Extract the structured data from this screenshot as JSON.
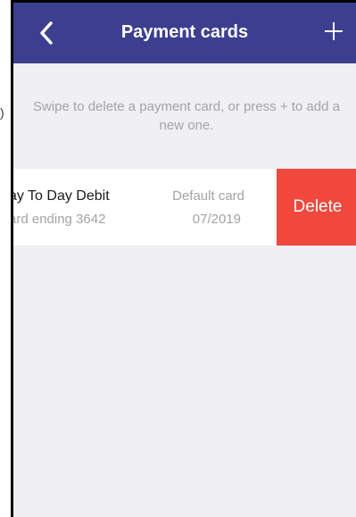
{
  "outer": {
    "fragment": ")"
  },
  "navbar": {
    "title": "Payment cards",
    "back_icon": "chevron-left-icon",
    "add_icon": "plus-icon",
    "background": "#3c3f8f"
  },
  "hint": {
    "text": "Swipe to delete a payment card, or press + to add a new one."
  },
  "cards": [
    {
      "name": "ay To Day Debit",
      "ending": "ard ending 3642",
      "status": "Default card",
      "expiry": "07/2019",
      "delete_label": "Delete"
    }
  ],
  "colors": {
    "delete": "#f0483d",
    "secondary_text": "#a3a3a8",
    "screen_background": "#efeff4"
  }
}
